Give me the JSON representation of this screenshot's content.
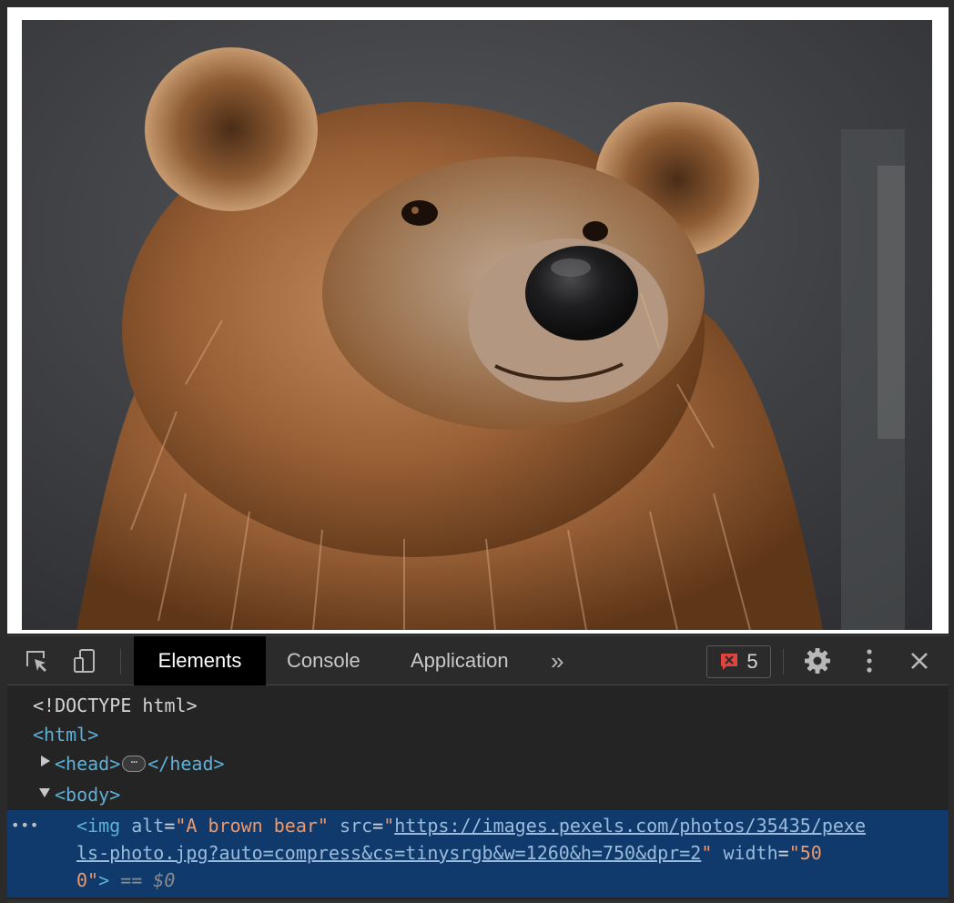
{
  "page": {
    "image_alt": "A brown bear"
  },
  "devtools": {
    "tabs": [
      {
        "label": "Elements",
        "active": true
      },
      {
        "label": "Console",
        "active": false
      },
      {
        "label": "Application",
        "active": false
      }
    ],
    "more_tabs_glyph": "»",
    "error_count": "5",
    "icons": {
      "inspect": "inspect-element-icon",
      "device": "device-toolbar-icon",
      "error": "error-x-icon",
      "settings": "gear-icon",
      "menu": "kebab-menu-icon",
      "close": "close-icon"
    },
    "colors": {
      "error_red": "#e0443e",
      "tag": "#5db0d7",
      "attr_value": "#f29766",
      "selection": "#0f3a6b"
    }
  },
  "dom": {
    "doctype": "<!DOCTYPE html>",
    "html_open": "<html>",
    "head_open": "<head>",
    "head_close": "</head>",
    "head_ellipsis": "⋯",
    "body_open": "<body>",
    "img": {
      "tag_open": "<img",
      "alt_attr": "alt",
      "alt_value": "\"A brown bear\"",
      "src_attr": "src",
      "src_quote_open": "\"",
      "src_url_part1": "https://images.pexels.com/photos/35435/pexe",
      "src_url_part2": "ls-photo.jpg?auto=compress&cs=tinysrgb&w=1260&h=750&dpr=2",
      "src_quote_close": "\"",
      "width_attr": "width",
      "width_value_part1": "\"50",
      "width_value_part2": "0\"",
      "tag_close": ">",
      "dollar_ref": "== $0"
    }
  }
}
